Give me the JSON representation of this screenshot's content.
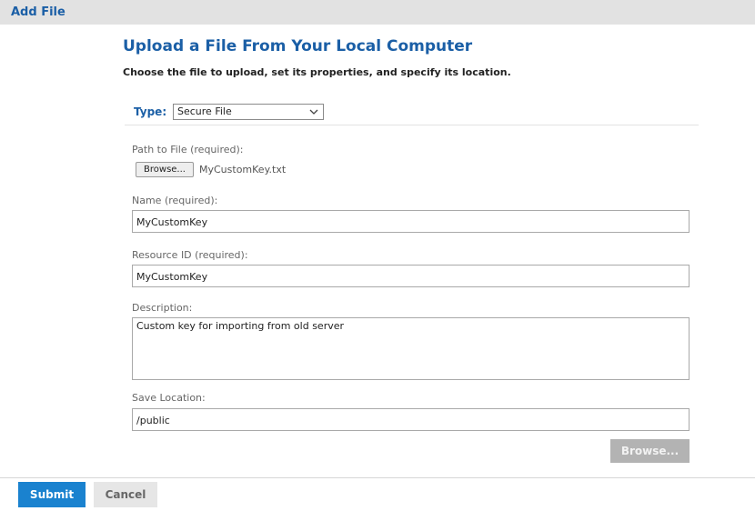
{
  "window": {
    "title": "Add File"
  },
  "header": {
    "title": "Upload a File From Your Local Computer",
    "subtitle": "Choose the file to upload, set its properties, and specify its location."
  },
  "type": {
    "label": "Type:",
    "selected": "Secure File",
    "icon": "chevron-down-icon"
  },
  "path": {
    "label": "Path to File (required):",
    "browse_label": "Browse...",
    "filename": "MyCustomKey.txt"
  },
  "name": {
    "label": "Name (required):",
    "value": "MyCustomKey"
  },
  "resource_id": {
    "label": "Resource ID (required):",
    "value": "MyCustomKey"
  },
  "description": {
    "label": "Description:",
    "value": "Custom key for importing from old server"
  },
  "save_location": {
    "label": "Save Location:",
    "value": "/public",
    "browse_label": "Browse..."
  },
  "footer": {
    "submit_label": "Submit",
    "cancel_label": "Cancel"
  },
  "colors": {
    "accent": "#1b5fa6",
    "primary_button": "#1a82cf",
    "disabled_button": "#b3b3b3"
  }
}
